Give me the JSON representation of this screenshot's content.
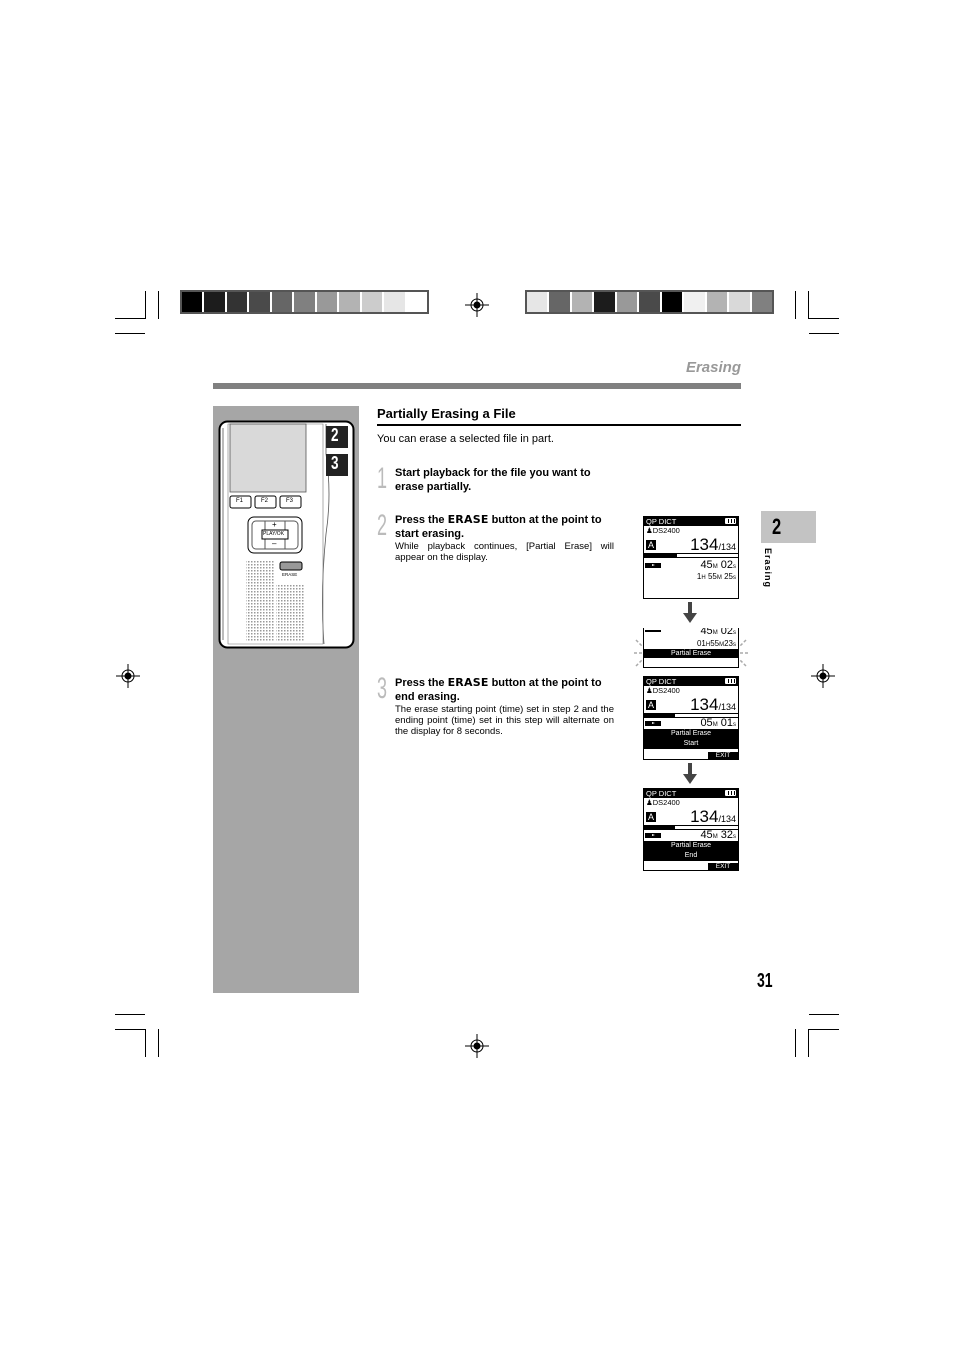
{
  "header": {
    "section_title": "Erasing"
  },
  "color_bars": {
    "left": [
      "#000000",
      "#1c1c1c",
      "#333333",
      "#4a4a4a",
      "#666666",
      "#808080",
      "#999999",
      "#b3b3b3",
      "#cccccc",
      "#e6e6e6",
      "#ffffff"
    ],
    "right": [
      "#e6e6e6",
      "#666666",
      "#b3b3b3",
      "#1c1c1c",
      "#999999",
      "#4a4a4a",
      "#000000",
      "#f0f0f0",
      "#b3b3b3",
      "#d9d9d9",
      "#808080"
    ]
  },
  "main": {
    "title": "Partially Erasing a File",
    "intro": "You can erase a selected file in part.",
    "steps": [
      {
        "number": "1",
        "title_pre": "Start playback for the file you want to erase partially.",
        "keyword": "",
        "title_post": "",
        "body": ""
      },
      {
        "number": "2",
        "title_pre": "Press the ",
        "keyword": "ERASE",
        "title_post": " button at the point to start erasing.",
        "body": "While playback continues, [Partial Erase] will appear on the display."
      },
      {
        "number": "3",
        "title_pre": "Press the ",
        "keyword": "ERASE",
        "title_post": " button at the point to end erasing.",
        "body": "The erase starting point (time) set in step 2 and the ending point (time) set in this step will alternate on the display for 8 seconds."
      }
    ]
  },
  "device": {
    "callouts": [
      "2",
      "3"
    ],
    "buttons": [
      "F1",
      "F2",
      "F3"
    ],
    "playok_label": "PLAY/OK",
    "plus": "+",
    "minus": "–",
    "erase_label": "ERASE"
  },
  "screens": [
    {
      "mode": "QP DICT",
      "user": "DS2400",
      "folder": "A",
      "file_num": "134",
      "file_total": "/134",
      "progress": 0.35,
      "time1_m": "45",
      "time1_s": "02",
      "time2_h": "1",
      "time2_m": "55",
      "time2_s": "25"
    },
    {
      "time1_m": "45",
      "time1_s": "02",
      "time2_h": "01",
      "time2_m": "55",
      "time2_s": "23",
      "banner": "Partial Erase"
    },
    {
      "mode": "QP DICT",
      "user": "DS2400",
      "folder": "A",
      "file_num": "134",
      "file_total": "/134",
      "progress": 0.33,
      "time1_m": "05",
      "time1_s": "01",
      "banner1": "Partial Erase",
      "banner2": "Start",
      "exit": "EXIT"
    },
    {
      "mode": "QP DICT",
      "user": "DS2400",
      "folder": "A",
      "file_num": "134",
      "file_total": "/134",
      "progress": 0.33,
      "time1_m": "45",
      "time1_s": "32",
      "banner1": "Partial Erase",
      "banner2": "End",
      "exit": "EXIT"
    }
  ],
  "units": {
    "h": "H",
    "m": "M",
    "s": "s"
  },
  "chapter_tab": {
    "number": "2",
    "label": "Erasing"
  },
  "page_number": "31"
}
